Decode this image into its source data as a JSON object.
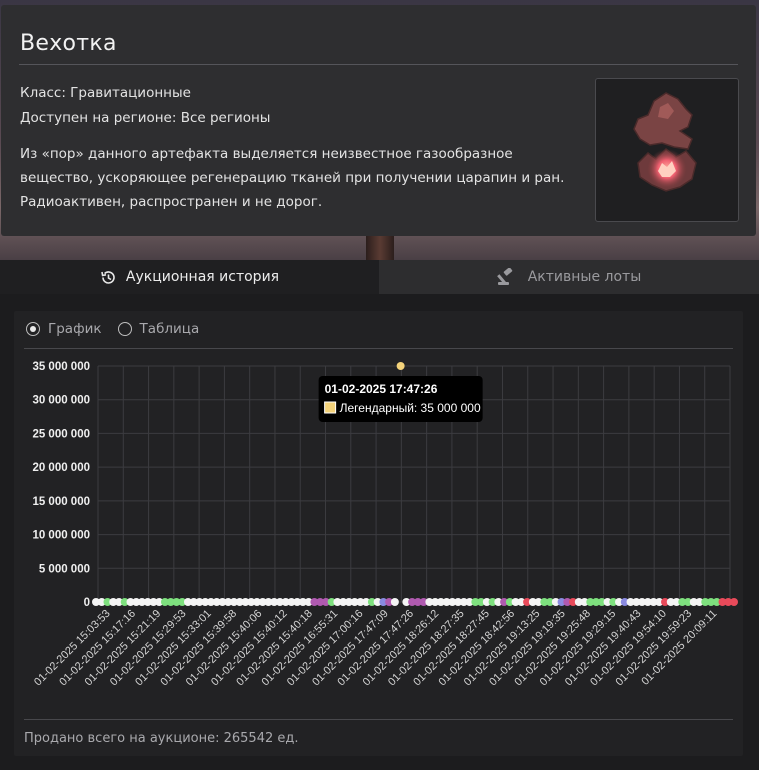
{
  "artifact": {
    "name": "Вехотка",
    "class_line": "Класс: Гравитационные",
    "region_line": "Доступен на регионе: Все регионы",
    "description": "Из «пор» данного артефакта выделяется неизвестное газообразное вещество, ускоряющее регенерацию тканей при получении царапин и ран. Радиоактивен, распространен и не дорог."
  },
  "tabs": [
    {
      "label": "Аукционная история",
      "icon": "history-icon",
      "active": true
    },
    {
      "label": "Активные лоты",
      "icon": "gavel-icon",
      "active": false
    }
  ],
  "view_toggle": {
    "options": [
      {
        "label": "График",
        "selected": true
      },
      {
        "label": "Таблица",
        "selected": false
      }
    ]
  },
  "chart_data": {
    "type": "scatter",
    "title": "",
    "xlabel": "",
    "ylabel": "",
    "ylim": [
      0,
      35000000
    ],
    "y_ticks": [
      "0",
      "5 000 000",
      "10 000 000",
      "15 000 000",
      "20 000 000",
      "25 000 000",
      "30 000 000",
      "35 000 000"
    ],
    "x_tick_labels": [
      "01-02-2025 15:03:53",
      "01-02-2025 15:17:16",
      "01-02-2025 15:21:19",
      "01-02-2025 15:29:53",
      "01-02-2025 15:33:01",
      "01-02-2025 15:39:58",
      "01-02-2025 15:40:06",
      "01-02-2025 15:40:12",
      "01-02-2025 15:40:18",
      "01-02-2025 16:55:31",
      "01-02-2025 17:00:16",
      "01-02-2025 17:47:09",
      "01-02-2025 17:47:26",
      "01-02-2025 18:26:12",
      "01-02-2025 18:27:35",
      "01-02-2025 18:27:45",
      "01-02-2025 18:42:56",
      "01-02-2025 19:13:25",
      "01-02-2025 19:19:35",
      "01-02-2025 19:25:48",
      "01-02-2025 19:29:15",
      "01-02-2025 19:40:43",
      "01-02-2025 19:54:10",
      "01-02-2025 19:59:23",
      "01-02-2025 20:09:11"
    ],
    "rarity_colors": {
      "common": "#f4f4f4",
      "uncommon": "#7ee07e",
      "rare": "#8a8ae0",
      "epic": "#b05ab0",
      "exceptional": "#e84a5a",
      "legendary": "#f3d27a"
    },
    "points_rarity": [
      "common",
      "common",
      "uncommon",
      "common",
      "common",
      "uncommon",
      "common",
      "common",
      "common",
      "common",
      "common",
      "common",
      "uncommon",
      "uncommon",
      "uncommon",
      "uncommon",
      "common",
      "common",
      "common",
      "common",
      "common",
      "common",
      "common",
      "common",
      "common",
      "common",
      "common",
      "common",
      "common",
      "common",
      "common",
      "common",
      "common",
      "common",
      "common",
      "common",
      "common",
      "common",
      "epic",
      "epic",
      "epic",
      "uncommon",
      "common",
      "common",
      "common",
      "common",
      "common",
      "common",
      "uncommon",
      "common",
      "rare",
      "epic",
      "common",
      "legendary",
      "common",
      "epic",
      "epic",
      "epic",
      "common",
      "common",
      "common",
      "common",
      "common",
      "common",
      "common",
      "common",
      "uncommon",
      "uncommon",
      "common",
      "uncommon",
      "common",
      "epic",
      "uncommon",
      "common",
      "common",
      "exceptional",
      "common",
      "common",
      "uncommon",
      "uncommon",
      "common",
      "rare",
      "epic",
      "exceptional",
      "common",
      "common",
      "uncommon",
      "uncommon",
      "uncommon",
      "common",
      "uncommon",
      "common",
      "rare",
      "common",
      "common",
      "common",
      "common",
      "common",
      "common",
      "exceptional",
      "common",
      "common",
      "uncommon",
      "uncommon",
      "common",
      "common",
      "uncommon",
      "uncommon",
      "uncommon",
      "exceptional",
      "exceptional",
      "exceptional"
    ],
    "point_values_note": "",
    "legendary_index": 53,
    "legendary_value": 35000000,
    "tooltip": {
      "date": "01-02-2025 17:47:26",
      "series_label": "Легендарный: 35 000 000"
    }
  },
  "footer": {
    "total_sold": "Продано всего на аукционе: 265542 ед."
  }
}
